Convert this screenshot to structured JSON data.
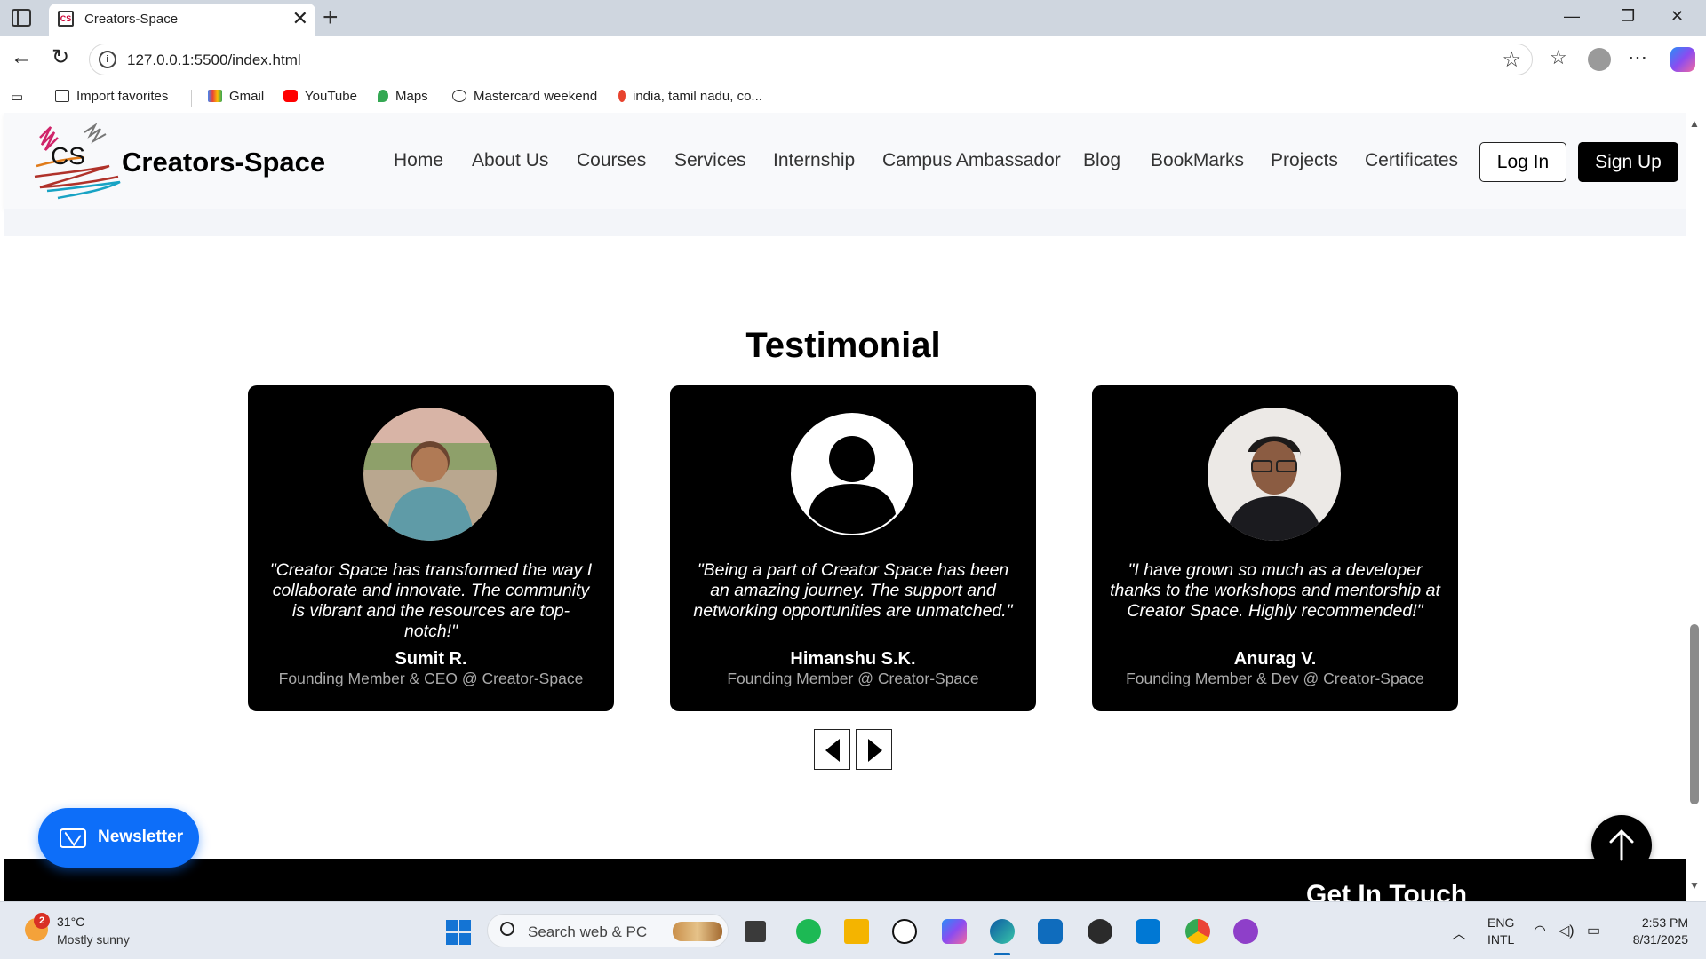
{
  "browser": {
    "tab_title": "Creators-Space",
    "tab_favicon_text": "CS",
    "url": "127.0.0.1:5500/index.html",
    "favorites": [
      {
        "label": "Import favorites",
        "icon": "import-icon"
      },
      {
        "label": "Gmail",
        "icon": "gmail-icon"
      },
      {
        "label": "YouTube",
        "icon": "youtube-icon"
      },
      {
        "label": "Maps",
        "icon": "maps-icon"
      },
      {
        "label": "Mastercard weekend",
        "icon": "globe-icon"
      },
      {
        "label": "india, tamil nadu, co...",
        "icon": "flame-icon"
      }
    ]
  },
  "site": {
    "logo_text": "CS",
    "brand": "Creators-Space",
    "nav": [
      "Home",
      "About Us",
      "Courses",
      "Services",
      "Internship",
      "Campus Ambassador",
      "Blog",
      "BookMarks",
      "Projects",
      "Certificates"
    ],
    "login_label": "Log In",
    "signup_label": "Sign Up"
  },
  "testimonials": {
    "title": "Testimonial",
    "items": [
      {
        "quote": "\"Creator Space has transformed the way I collaborate and innovate. The community is vibrant and the resources are top-notch!\"",
        "name": "Sumit R.",
        "role": "Founding Member & CEO @ Creator-Space",
        "avatar": "photo-avatar"
      },
      {
        "quote": "\"Being a part of Creator Space has been an amazing journey. The support and networking opportunities are unmatched.\"",
        "name": "Himanshu S.K.",
        "role": "Founding Member @ Creator-Space",
        "avatar": "default-user-avatar"
      },
      {
        "quote": "\"I have grown so much as a developer thanks to the workshops and mentorship at Creator Space. Highly recommended!\"",
        "name": "Anurag V.",
        "role": "Founding Member & Dev @ Creator-Space",
        "avatar": "photo-avatar"
      }
    ]
  },
  "newsletter_label": "Newsletter",
  "footer": {
    "heading": "Get In Touch"
  },
  "taskbar": {
    "weather_badge": "2",
    "weather_temp": "31°C",
    "weather_desc": "Mostly sunny",
    "search_placeholder": "Search web & PC",
    "lang_line1": "ENG",
    "lang_line2": "INTL",
    "time": "2:53 PM",
    "date": "8/31/2025"
  },
  "colors": {
    "newsletter_blue": "#0d6ef9",
    "card_bg": "#000000",
    "signup_bg": "#000000"
  }
}
